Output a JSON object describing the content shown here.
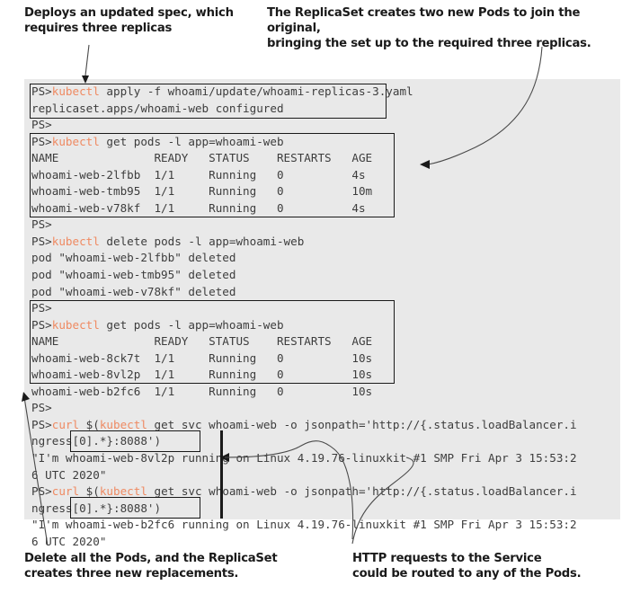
{
  "callouts": {
    "top_left": "Deploys an updated spec, which\nrequires three replicas",
    "top_right": "The ReplicaSet creates two new Pods to join the original,\nbringing the set up to the required three replicas.",
    "bottom_left": "Delete all the Pods, and the ReplicaSet\ncreates three new replacements.",
    "bottom_right": "HTTP requests to the Service\ncould be routed to any of the Pods."
  },
  "terminal": {
    "prompt": "PS>",
    "colors": {
      "background": "#e9e9e9",
      "text": "#3d3d3d",
      "command": "#ef8a62",
      "box_border": "#1a1a1a"
    },
    "lines": [
      {
        "prompt": "PS>",
        "cmd": "kubectl",
        "rest": " apply -f whoami/update/whoami-replicas-3.yaml"
      },
      {
        "prompt": "",
        "cmd": "",
        "rest": "replicaset.apps/whoami-web configured"
      },
      {
        "prompt": "PS>",
        "cmd": "",
        "rest": ""
      },
      {
        "prompt": "PS>",
        "cmd": "kubectl",
        "rest": " get pods -l app=whoami-web"
      },
      {
        "prompt": "",
        "cmd": "",
        "rest": "NAME              READY   STATUS    RESTARTS   AGE"
      },
      {
        "prompt": "",
        "cmd": "",
        "rest": "whoami-web-2lfbb  1/1     Running   0          4s"
      },
      {
        "prompt": "",
        "cmd": "",
        "rest": "whoami-web-tmb95  1/1     Running   0          10m"
      },
      {
        "prompt": "",
        "cmd": "",
        "rest": "whoami-web-v78kf  1/1     Running   0          4s"
      },
      {
        "prompt": "PS>",
        "cmd": "",
        "rest": ""
      },
      {
        "prompt": "PS>",
        "cmd": "kubectl",
        "rest": " delete pods -l app=whoami-web"
      },
      {
        "prompt": "",
        "cmd": "",
        "rest": "pod \"whoami-web-2lfbb\" deleted"
      },
      {
        "prompt": "",
        "cmd": "",
        "rest": "pod \"whoami-web-tmb95\" deleted"
      },
      {
        "prompt": "",
        "cmd": "",
        "rest": "pod \"whoami-web-v78kf\" deleted"
      },
      {
        "prompt": "PS>",
        "cmd": "",
        "rest": ""
      },
      {
        "prompt": "PS>",
        "cmd": "kubectl",
        "rest": " get pods -l app=whoami-web"
      },
      {
        "prompt": "",
        "cmd": "",
        "rest": "NAME              READY   STATUS    RESTARTS   AGE"
      },
      {
        "prompt": "",
        "cmd": "",
        "rest": "whoami-web-8ck7t  1/1     Running   0          10s"
      },
      {
        "prompt": "",
        "cmd": "",
        "rest": "whoami-web-8vl2p  1/1     Running   0          10s"
      },
      {
        "prompt": "",
        "cmd": "",
        "rest": "whoami-web-b2fc6  1/1     Running   0          10s"
      },
      {
        "prompt": "PS>",
        "cmd": "",
        "rest": ""
      },
      {
        "prompt": "PS>",
        "cmd": "curl",
        "rest": " $(",
        "cmd2": "kubectl",
        "rest2": " get svc whoami-web -o jsonpath='http://{.status.loadBalancer.i"
      },
      {
        "prompt": "",
        "cmd": "",
        "rest": "ngress[0].*}:8088')"
      },
      {
        "prompt": "",
        "cmd": "",
        "rest": "\"I'm whoami-web-8vl2p running on Linux 4.19.76-linuxkit #1 SMP Fri Apr 3 15:53:2"
      },
      {
        "prompt": "",
        "cmd": "",
        "rest": "6 UTC 2020\""
      },
      {
        "prompt": "PS>",
        "cmd": "curl",
        "rest": " $(",
        "cmd2": "kubectl",
        "rest2": " get svc whoami-web -o jsonpath='http://{.status.loadBalancer.i"
      },
      {
        "prompt": "",
        "cmd": "",
        "rest": "ngress[0].*}:8088')"
      },
      {
        "prompt": "",
        "cmd": "",
        "rest": "\"I'm whoami-web-b2fc6 running on Linux 4.19.76-linuxkit #1 SMP Fri Apr 3 15:53:2"
      },
      {
        "prompt": "",
        "cmd": "",
        "rest": "6 UTC 2020\""
      }
    ],
    "highlight_boxes": [
      {
        "name": "apply-command-box",
        "label": "kubectl apply -f whoami/update/whoami-replicas-3.yaml"
      },
      {
        "name": "first-get-pods-box",
        "label": "kubectl get pods -l app=whoami-web (three pods: 4s, 10m, 4s)"
      },
      {
        "name": "second-get-pods-box",
        "label": "kubectl get pods -l app=whoami-web (three pods: 10s, 10s, 10s)"
      },
      {
        "name": "pod-name-8vl2p-box",
        "label": "whoami-web-8vl2p"
      },
      {
        "name": "pod-name-b2fc6-box",
        "label": "whoami-web-b2fc6"
      }
    ]
  }
}
